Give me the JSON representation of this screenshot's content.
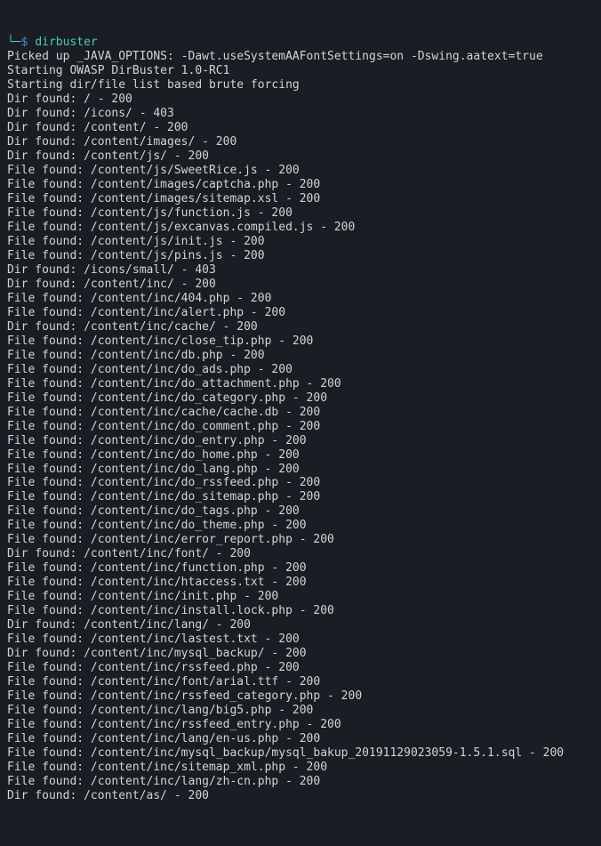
{
  "prompt": {
    "tree": "└─",
    "dollar": "$",
    "command": "dirbuster"
  },
  "lines": [
    "Picked up _JAVA_OPTIONS: -Dawt.useSystemAAFontSettings=on -Dswing.aatext=true",
    "Starting OWASP DirBuster 1.0-RC1",
    "Starting dir/file list based brute forcing",
    "Dir found: / - 200",
    "Dir found: /icons/ - 403",
    "Dir found: /content/ - 200",
    "Dir found: /content/images/ - 200",
    "Dir found: /content/js/ - 200",
    "File found: /content/js/SweetRice.js - 200",
    "File found: /content/images/captcha.php - 200",
    "File found: /content/images/sitemap.xsl - 200",
    "File found: /content/js/function.js - 200",
    "File found: /content/js/excanvas.compiled.js - 200",
    "File found: /content/js/init.js - 200",
    "File found: /content/js/pins.js - 200",
    "Dir found: /icons/small/ - 403",
    "Dir found: /content/inc/ - 200",
    "File found: /content/inc/404.php - 200",
    "File found: /content/inc/alert.php - 200",
    "Dir found: /content/inc/cache/ - 200",
    "File found: /content/inc/close_tip.php - 200",
    "File found: /content/inc/db.php - 200",
    "File found: /content/inc/do_ads.php - 200",
    "File found: /content/inc/do_attachment.php - 200",
    "File found: /content/inc/do_category.php - 200",
    "File found: /content/inc/cache/cache.db - 200",
    "File found: /content/inc/do_comment.php - 200",
    "File found: /content/inc/do_entry.php - 200",
    "File found: /content/inc/do_home.php - 200",
    "File found: /content/inc/do_lang.php - 200",
    "File found: /content/inc/do_rssfeed.php - 200",
    "File found: /content/inc/do_sitemap.php - 200",
    "File found: /content/inc/do_tags.php - 200",
    "File found: /content/inc/do_theme.php - 200",
    "File found: /content/inc/error_report.php - 200",
    "Dir found: /content/inc/font/ - 200",
    "File found: /content/inc/function.php - 200",
    "File found: /content/inc/htaccess.txt - 200",
    "File found: /content/inc/init.php - 200",
    "File found: /content/inc/install.lock.php - 200",
    "Dir found: /content/inc/lang/ - 200",
    "File found: /content/inc/lastest.txt - 200",
    "Dir found: /content/inc/mysql_backup/ - 200",
    "File found: /content/inc/rssfeed.php - 200",
    "File found: /content/inc/font/arial.ttf - 200",
    "File found: /content/inc/rssfeed_category.php - 200",
    "File found: /content/inc/lang/big5.php - 200",
    "File found: /content/inc/rssfeed_entry.php - 200",
    "File found: /content/inc/lang/en-us.php - 200",
    "File found: /content/inc/mysql_backup/mysql_bakup_20191129023059-1.5.1.sql - 200",
    "File found: /content/inc/sitemap_xml.php - 200",
    "File found: /content/inc/lang/zh-cn.php - 200",
    "Dir found: /content/as/ - 200"
  ]
}
